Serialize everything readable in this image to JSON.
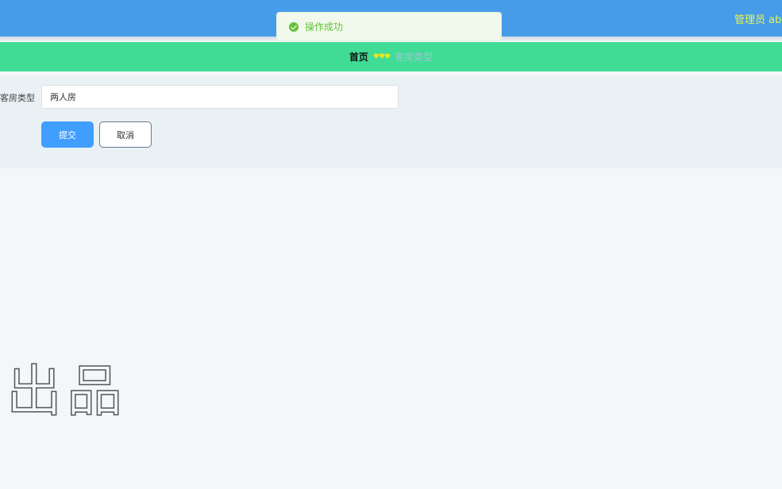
{
  "header": {
    "user_label": "管理员 ab"
  },
  "toast": {
    "message": "操作成功",
    "icon": "check-circle-icon",
    "color": "#67c23a"
  },
  "breadcrumb": {
    "home": "首页",
    "separator": "♥♥♥",
    "current": "客房类型"
  },
  "form": {
    "field_label": "客房类型",
    "field_value": "两人房",
    "submit_label": "提交",
    "cancel_label": "取消"
  },
  "watermark": {
    "text": "出品"
  },
  "colors": {
    "header_bg": "#479cea",
    "navbar_bg": "#40dc96",
    "primary": "#409eff",
    "user_text": "#e6f54f"
  }
}
